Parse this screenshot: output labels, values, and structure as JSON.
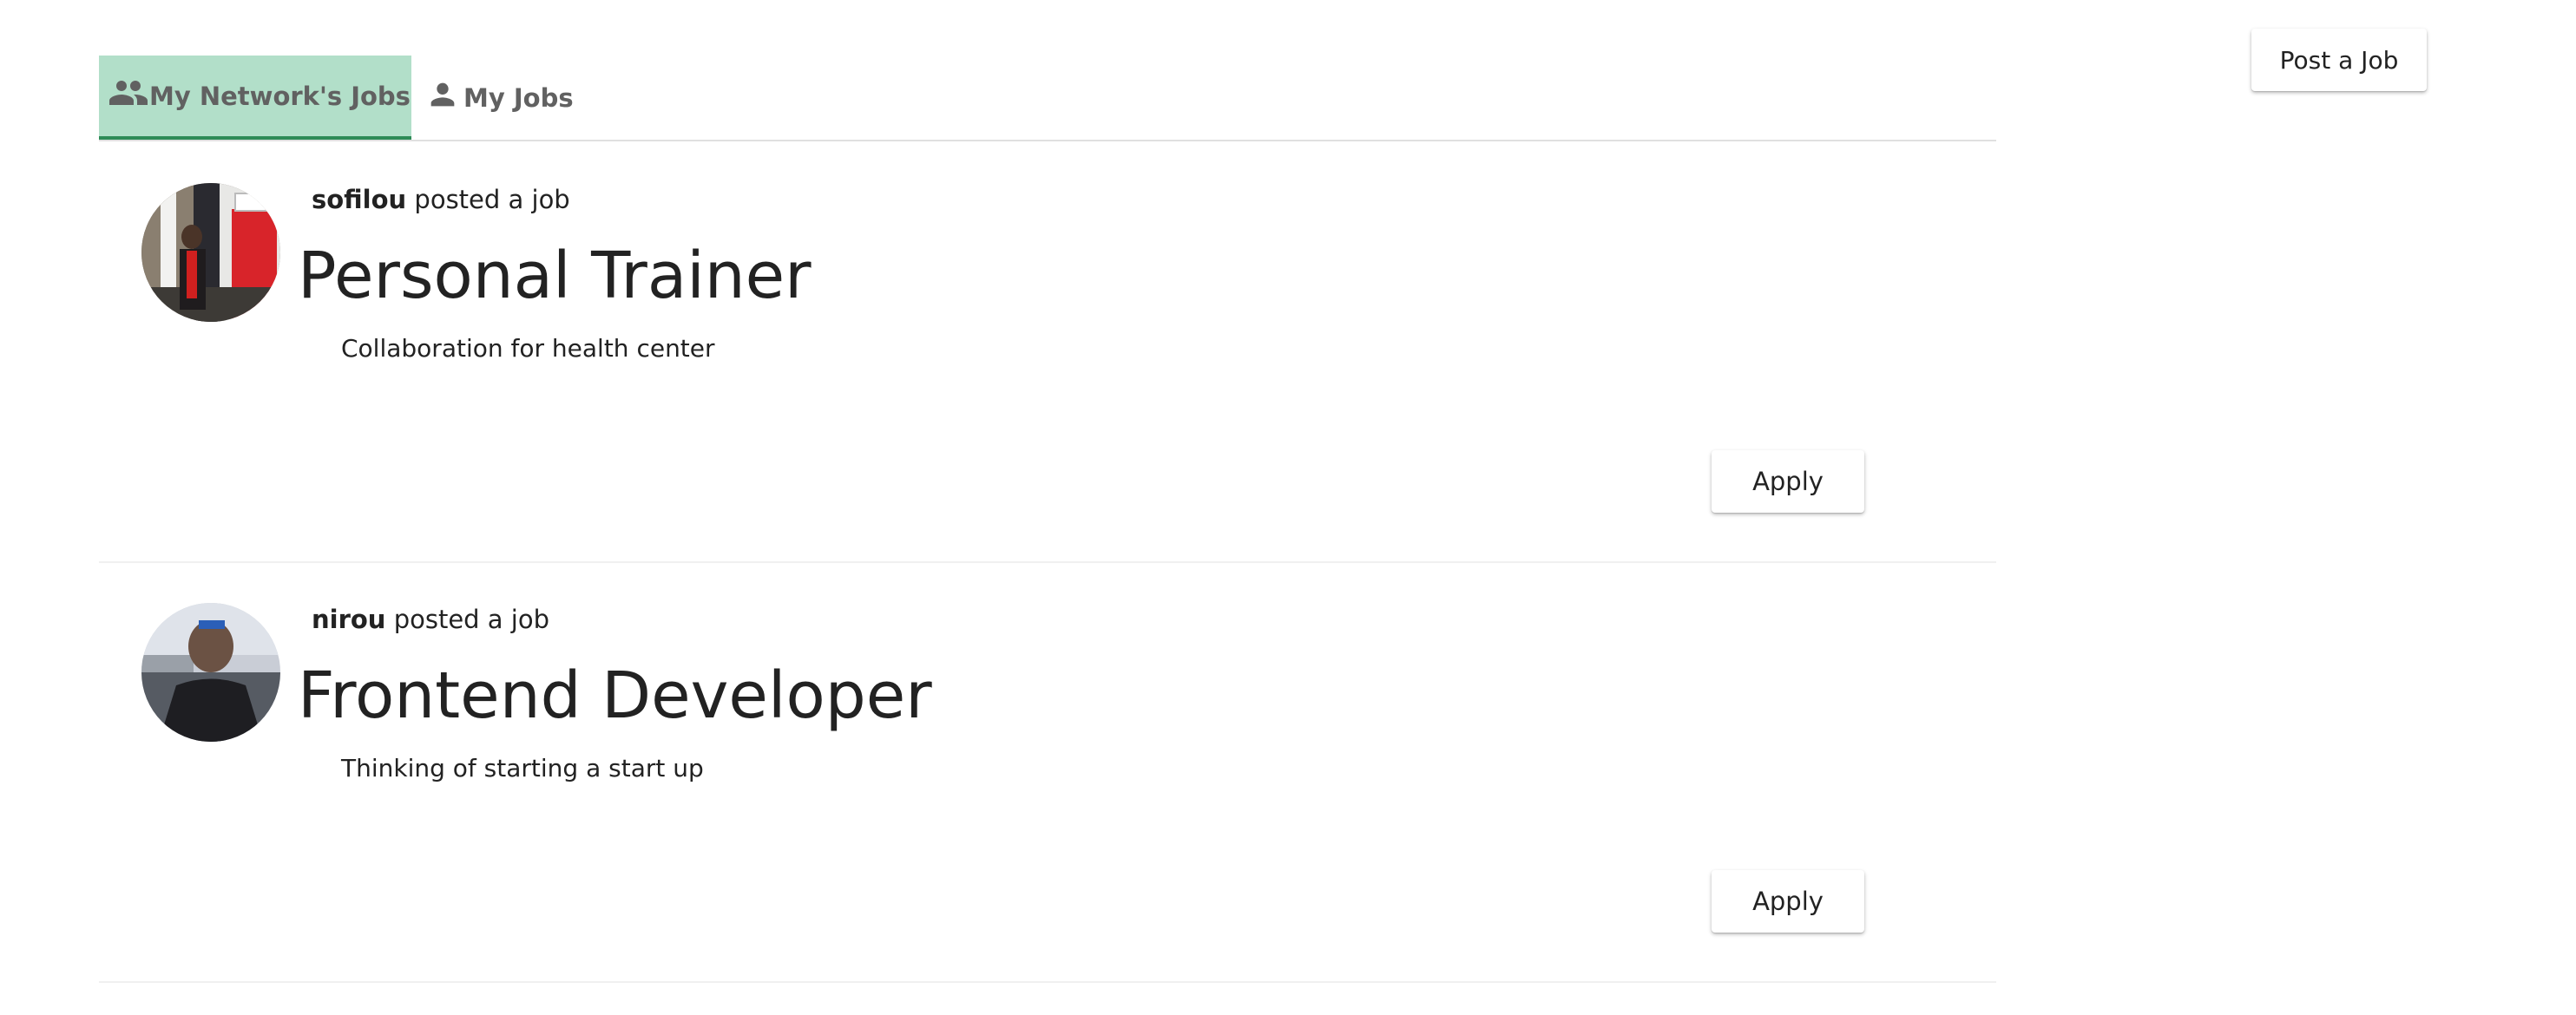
{
  "header": {
    "post_job_label": "Post a Job"
  },
  "tabs": [
    {
      "label": "My Network's Jobs",
      "icon": "people-icon",
      "active": true
    },
    {
      "label": "My Jobs",
      "icon": "person-icon",
      "active": false
    }
  ],
  "jobs": [
    {
      "poster": "sofilou",
      "action": "posted a job",
      "title": "Personal Trainer",
      "description": "Collaboration for health center",
      "apply_label": "Apply"
    },
    {
      "poster": "nirou",
      "action": "posted a job",
      "title": "Frontend Developer",
      "description": "Thinking of starting a start up",
      "apply_label": "Apply"
    }
  ],
  "colors": {
    "active_tab_bg": "#b2dfc9",
    "active_tab_underline": "#2e8b57",
    "tab_text": "#616161"
  }
}
